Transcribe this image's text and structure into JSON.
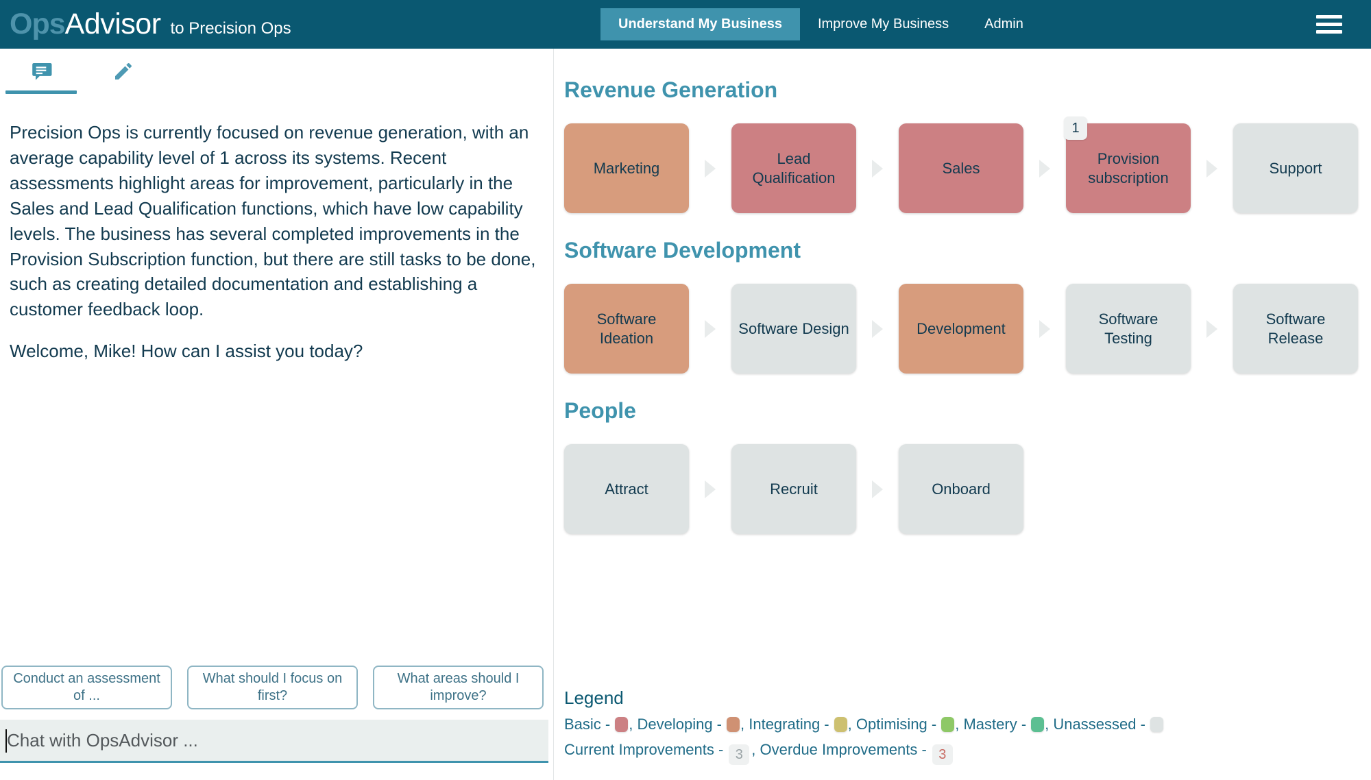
{
  "header": {
    "brand_primary": "Ops",
    "brand_secondary": "Advisor",
    "brand_subtitle": "to Precision Ops",
    "nav": [
      {
        "label": "Understand My Business",
        "active": true
      },
      {
        "label": "Improve My Business",
        "active": false
      },
      {
        "label": "Admin",
        "active": false
      }
    ],
    "menu_icon": "hamburger-menu-icon",
    "bg_color": "#0a5871",
    "active_tab_color": "#3f93ad"
  },
  "left_panel": {
    "tabs": [
      {
        "icon": "chat-bubble-icon",
        "active": true
      },
      {
        "icon": "pencil-edit-icon",
        "active": false
      }
    ],
    "messages": [
      "Precision Ops is currently focused on revenue generation, with an average capability level of 1 across its systems. Recent assessments highlight areas for improvement, particularly in the Sales and Lead Qualification functions, which have low capability levels. The business has several completed improvements in the Provision Subscription function, but there are still tasks to be done, such as creating detailed documentation and establishing a customer feedback loop.",
      "Welcome, Mike! How can I assist you today?"
    ],
    "suggestions": [
      "Conduct an assessment of ...",
      "What should I focus on first?",
      "What areas should I improve?"
    ],
    "input": {
      "placeholder": "Chat with OpsAdvisor ...",
      "value": ""
    }
  },
  "chart_data": {
    "type": "table",
    "title": "Business Capability Value Streams",
    "sections": [
      {
        "title": "Revenue Generation",
        "cards": [
          {
            "label": "Marketing",
            "level": "Integrating",
            "color": "#d79c7d",
            "badge": null
          },
          {
            "label": "Lead Qualification",
            "level": "Basic",
            "color": "#cc8083",
            "badge": null
          },
          {
            "label": "Sales",
            "level": "Basic",
            "color": "#cc8083",
            "badge": null
          },
          {
            "label": "Provision subscription",
            "level": "Basic",
            "color": "#cc8083",
            "badge": "1"
          },
          {
            "label": "Support",
            "level": "Unassessed",
            "color": "#dee3e3",
            "badge": null
          }
        ]
      },
      {
        "title": "Software Development",
        "cards": [
          {
            "label": "Software Ideation",
            "level": "Developing",
            "color": "#d79c7d",
            "badge": null
          },
          {
            "label": "Software Design",
            "level": "Unassessed",
            "color": "#dee3e3",
            "badge": null
          },
          {
            "label": "Development",
            "level": "Developing",
            "color": "#d79c7d",
            "badge": null
          },
          {
            "label": "Software Testing",
            "level": "Unassessed",
            "color": "#dee3e3",
            "badge": null
          },
          {
            "label": "Software Release",
            "level": "Unassessed",
            "color": "#dee3e3",
            "badge": null
          }
        ]
      },
      {
        "title": "People",
        "cards": [
          {
            "label": "Attract",
            "level": "Unassessed",
            "color": "#dee3e3",
            "badge": null
          },
          {
            "label": "Recruit",
            "level": "Unassessed",
            "color": "#dee3e3",
            "badge": null
          },
          {
            "label": "Onboard",
            "level": "Unassessed",
            "color": "#dee3e3",
            "badge": null
          }
        ]
      }
    ]
  },
  "legend": {
    "title": "Legend",
    "levels": [
      {
        "label": "Basic",
        "color": "#cc8083"
      },
      {
        "label": "Developing",
        "color": "#cf9173"
      },
      {
        "label": "Integrating",
        "color": "#cdc070"
      },
      {
        "label": "Optimising",
        "color": "#8ec866"
      },
      {
        "label": "Mastery",
        "color": "#5cbf92"
      },
      {
        "label": "Unassessed",
        "color": "#dee3e3"
      }
    ],
    "improvements": [
      {
        "label": "Current Improvements",
        "count": "3",
        "text_color": "#9aa3a6"
      },
      {
        "label": "Overdue Improvements",
        "count": "3",
        "text_color": "#c86a62"
      }
    ]
  }
}
